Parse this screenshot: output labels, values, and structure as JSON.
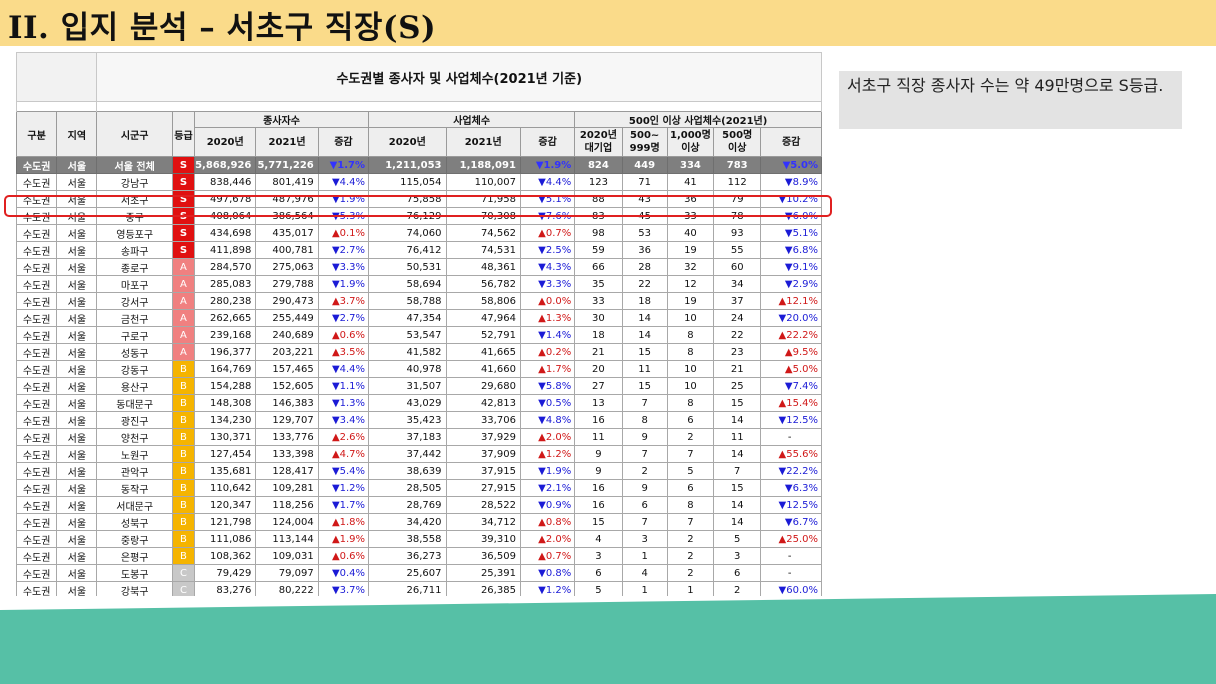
{
  "slide_title": "II. 입지 분석 – 서초구 직장(S)",
  "note": "서초구 직장 종사자 수는 약 49만명으로 S등급.",
  "table": {
    "caption": "수도권별 종사자 및 사업체수(2021년 기준)",
    "headers": {
      "gubun": "구분",
      "region": "지역",
      "district": "시군구",
      "grade": "등급",
      "workers": "종사자수",
      "businesses": "사업체수",
      "large": "500인 이상 사업체수(2021년)",
      "y2020": "2020년",
      "y2021": "2021년",
      "change": "증감",
      "large_corp": "2020년\n대기업",
      "b500_999": "500~\n999명",
      "b1000": "1,000명\n이상",
      "b500": "500명\n이상"
    },
    "rows": [
      {
        "g": "수도권",
        "r": "서울",
        "d": "서울 전체",
        "grade": "S",
        "w20": "5,868,926",
        "w21": "5,771,226",
        "wc": "▼1.7%",
        "wd": "down",
        "b20": "1,211,053",
        "b21": "1,188,091",
        "bc": "▼1.9%",
        "bd": "down",
        "lc": "824",
        "l1": "449",
        "l2": "334",
        "l3": "783",
        "lchg": "▼5.0%",
        "ld": "down"
      },
      {
        "g": "수도권",
        "r": "서울",
        "d": "강남구",
        "grade": "S",
        "w20": "838,446",
        "w21": "801,419",
        "wc": "▼4.4%",
        "wd": "down",
        "b20": "115,054",
        "b21": "110,007",
        "bc": "▼4.4%",
        "bd": "down",
        "lc": "123",
        "l1": "71",
        "l2": "41",
        "l3": "112",
        "lchg": "▼8.9%",
        "ld": "down"
      },
      {
        "g": "수도권",
        "r": "서울",
        "d": "서초구",
        "grade": "S",
        "w20": "497,678",
        "w21": "487,976",
        "wc": "▼1.9%",
        "wd": "down",
        "b20": "75,858",
        "b21": "71,958",
        "bc": "▼5.1%",
        "bd": "down",
        "lc": "88",
        "l1": "43",
        "l2": "36",
        "l3": "79",
        "lchg": "▼10.2%",
        "ld": "down"
      },
      {
        "g": "수도권",
        "r": "서울",
        "d": "중구",
        "grade": "S",
        "w20": "408,064",
        "w21": "386,564",
        "wc": "▼5.3%",
        "wd": "down",
        "b20": "76,129",
        "b21": "70,308",
        "bc": "▼7.6%",
        "bd": "down",
        "lc": "83",
        "l1": "45",
        "l2": "33",
        "l3": "78",
        "lchg": "▼6.0%",
        "ld": "down"
      },
      {
        "g": "수도권",
        "r": "서울",
        "d": "영등포구",
        "grade": "S",
        "w20": "434,698",
        "w21": "435,017",
        "wc": "▲0.1%",
        "wd": "up",
        "b20": "74,060",
        "b21": "74,562",
        "bc": "▲0.7%",
        "bd": "up",
        "lc": "98",
        "l1": "53",
        "l2": "40",
        "l3": "93",
        "lchg": "▼5.1%",
        "ld": "down"
      },
      {
        "g": "수도권",
        "r": "서울",
        "d": "송파구",
        "grade": "S",
        "w20": "411,898",
        "w21": "400,781",
        "wc": "▼2.7%",
        "wd": "down",
        "b20": "76,412",
        "b21": "74,531",
        "bc": "▼2.5%",
        "bd": "down",
        "lc": "59",
        "l1": "36",
        "l2": "19",
        "l3": "55",
        "lchg": "▼6.8%",
        "ld": "down"
      },
      {
        "g": "수도권",
        "r": "서울",
        "d": "종로구",
        "grade": "A",
        "w20": "284,570",
        "w21": "275,063",
        "wc": "▼3.3%",
        "wd": "down",
        "b20": "50,531",
        "b21": "48,361",
        "bc": "▼4.3%",
        "bd": "down",
        "lc": "66",
        "l1": "28",
        "l2": "32",
        "l3": "60",
        "lchg": "▼9.1%",
        "ld": "down"
      },
      {
        "g": "수도권",
        "r": "서울",
        "d": "마포구",
        "grade": "A",
        "w20": "285,083",
        "w21": "279,788",
        "wc": "▼1.9%",
        "wd": "down",
        "b20": "58,694",
        "b21": "56,782",
        "bc": "▼3.3%",
        "bd": "down",
        "lc": "35",
        "l1": "22",
        "l2": "12",
        "l3": "34",
        "lchg": "▼2.9%",
        "ld": "down"
      },
      {
        "g": "수도권",
        "r": "서울",
        "d": "강서구",
        "grade": "A",
        "w20": "280,238",
        "w21": "290,473",
        "wc": "▲3.7%",
        "wd": "up",
        "b20": "58,788",
        "b21": "58,806",
        "bc": "▲0.0%",
        "bd": "up",
        "lc": "33",
        "l1": "18",
        "l2": "19",
        "l3": "37",
        "lchg": "▲12.1%",
        "ld": "up"
      },
      {
        "g": "수도권",
        "r": "서울",
        "d": "금천구",
        "grade": "A",
        "w20": "262,665",
        "w21": "255,449",
        "wc": "▼2.7%",
        "wd": "down",
        "b20": "47,354",
        "b21": "47,964",
        "bc": "▲1.3%",
        "bd": "up",
        "lc": "30",
        "l1": "14",
        "l2": "10",
        "l3": "24",
        "lchg": "▼20.0%",
        "ld": "down"
      },
      {
        "g": "수도권",
        "r": "서울",
        "d": "구로구",
        "grade": "A",
        "w20": "239,168",
        "w21": "240,689",
        "wc": "▲0.6%",
        "wd": "up",
        "b20": "53,547",
        "b21": "52,791",
        "bc": "▼1.4%",
        "bd": "down",
        "lc": "18",
        "l1": "14",
        "l2": "8",
        "l3": "22",
        "lchg": "▲22.2%",
        "ld": "up"
      },
      {
        "g": "수도권",
        "r": "서울",
        "d": "성동구",
        "grade": "A",
        "w20": "196,377",
        "w21": "203,221",
        "wc": "▲3.5%",
        "wd": "up",
        "b20": "41,582",
        "b21": "41,665",
        "bc": "▲0.2%",
        "bd": "up",
        "lc": "21",
        "l1": "15",
        "l2": "8",
        "l3": "23",
        "lchg": "▲9.5%",
        "ld": "up"
      },
      {
        "g": "수도권",
        "r": "서울",
        "d": "강동구",
        "grade": "B",
        "w20": "164,769",
        "w21": "157,465",
        "wc": "▼4.4%",
        "wd": "down",
        "b20": "40,978",
        "b21": "41,660",
        "bc": "▲1.7%",
        "bd": "up",
        "lc": "20",
        "l1": "11",
        "l2": "10",
        "l3": "21",
        "lchg": "▲5.0%",
        "ld": "up"
      },
      {
        "g": "수도권",
        "r": "서울",
        "d": "용산구",
        "grade": "B",
        "w20": "154,288",
        "w21": "152,605",
        "wc": "▼1.1%",
        "wd": "down",
        "b20": "31,507",
        "b21": "29,680",
        "bc": "▼5.8%",
        "bd": "down",
        "lc": "27",
        "l1": "15",
        "l2": "10",
        "l3": "25",
        "lchg": "▼7.4%",
        "ld": "down"
      },
      {
        "g": "수도권",
        "r": "서울",
        "d": "동대문구",
        "grade": "B",
        "w20": "148,308",
        "w21": "146,383",
        "wc": "▼1.3%",
        "wd": "down",
        "b20": "43,029",
        "b21": "42,813",
        "bc": "▼0.5%",
        "bd": "down",
        "lc": "13",
        "l1": "7",
        "l2": "8",
        "l3": "15",
        "lchg": "▲15.4%",
        "ld": "up"
      },
      {
        "g": "수도권",
        "r": "서울",
        "d": "광진구",
        "grade": "B",
        "w20": "134,230",
        "w21": "129,707",
        "wc": "▼3.4%",
        "wd": "down",
        "b20": "35,423",
        "b21": "33,706",
        "bc": "▼4.8%",
        "bd": "down",
        "lc": "16",
        "l1": "8",
        "l2": "6",
        "l3": "14",
        "lchg": "▼12.5%",
        "ld": "down"
      },
      {
        "g": "수도권",
        "r": "서울",
        "d": "양천구",
        "grade": "B",
        "w20": "130,371",
        "w21": "133,776",
        "wc": "▲2.6%",
        "wd": "up",
        "b20": "37,183",
        "b21": "37,929",
        "bc": "▲2.0%",
        "bd": "up",
        "lc": "11",
        "l1": "9",
        "l2": "2",
        "l3": "11",
        "lchg": "-",
        "ld": "none"
      },
      {
        "g": "수도권",
        "r": "서울",
        "d": "노원구",
        "grade": "B",
        "w20": "127,454",
        "w21": "133,398",
        "wc": "▲4.7%",
        "wd": "up",
        "b20": "37,442",
        "b21": "37,909",
        "bc": "▲1.2%",
        "bd": "up",
        "lc": "9",
        "l1": "7",
        "l2": "7",
        "l3": "14",
        "lchg": "▲55.6%",
        "ld": "up"
      },
      {
        "g": "수도권",
        "r": "서울",
        "d": "관악구",
        "grade": "B",
        "w20": "135,681",
        "w21": "128,417",
        "wc": "▼5.4%",
        "wd": "down",
        "b20": "38,639",
        "b21": "37,915",
        "bc": "▼1.9%",
        "bd": "down",
        "lc": "9",
        "l1": "2",
        "l2": "5",
        "l3": "7",
        "lchg": "▼22.2%",
        "ld": "down"
      },
      {
        "g": "수도권",
        "r": "서울",
        "d": "동작구",
        "grade": "B",
        "w20": "110,642",
        "w21": "109,281",
        "wc": "▼1.2%",
        "wd": "down",
        "b20": "28,505",
        "b21": "27,915",
        "bc": "▼2.1%",
        "bd": "down",
        "lc": "16",
        "l1": "9",
        "l2": "6",
        "l3": "15",
        "lchg": "▼6.3%",
        "ld": "down"
      },
      {
        "g": "수도권",
        "r": "서울",
        "d": "서대문구",
        "grade": "B",
        "w20": "120,347",
        "w21": "118,256",
        "wc": "▼1.7%",
        "wd": "down",
        "b20": "28,769",
        "b21": "28,522",
        "bc": "▼0.9%",
        "bd": "down",
        "lc": "16",
        "l1": "6",
        "l2": "8",
        "l3": "14",
        "lchg": "▼12.5%",
        "ld": "down"
      },
      {
        "g": "수도권",
        "r": "서울",
        "d": "성북구",
        "grade": "B",
        "w20": "121,798",
        "w21": "124,004",
        "wc": "▲1.8%",
        "wd": "up",
        "b20": "34,420",
        "b21": "34,712",
        "bc": "▲0.8%",
        "bd": "up",
        "lc": "15",
        "l1": "7",
        "l2": "7",
        "l3": "14",
        "lchg": "▼6.7%",
        "ld": "down"
      },
      {
        "g": "수도권",
        "r": "서울",
        "d": "중랑구",
        "grade": "B",
        "w20": "111,086",
        "w21": "113,144",
        "wc": "▲1.9%",
        "wd": "up",
        "b20": "38,558",
        "b21": "39,310",
        "bc": "▲2.0%",
        "bd": "up",
        "lc": "4",
        "l1": "3",
        "l2": "2",
        "l3": "5",
        "lchg": "▲25.0%",
        "ld": "up"
      },
      {
        "g": "수도권",
        "r": "서울",
        "d": "은평구",
        "grade": "B",
        "w20": "108,362",
        "w21": "109,031",
        "wc": "▲0.6%",
        "wd": "up",
        "b20": "36,273",
        "b21": "36,509",
        "bc": "▲0.7%",
        "bd": "up",
        "lc": "3",
        "l1": "1",
        "l2": "2",
        "l3": "3",
        "lchg": "-",
        "ld": "none"
      },
      {
        "g": "수도권",
        "r": "서울",
        "d": "도봉구",
        "grade": "C",
        "w20": "79,429",
        "w21": "79,097",
        "wc": "▼0.4%",
        "wd": "down",
        "b20": "25,607",
        "b21": "25,391",
        "bc": "▼0.8%",
        "bd": "down",
        "lc": "6",
        "l1": "4",
        "l2": "2",
        "l3": "6",
        "lchg": "-",
        "ld": "none"
      },
      {
        "g": "수도권",
        "r": "서울",
        "d": "강북구",
        "grade": "C",
        "w20": "83,276",
        "w21": "80,222",
        "wc": "▼3.7%",
        "wd": "down",
        "b20": "26,711",
        "b21": "26,385",
        "bc": "▼1.2%",
        "bd": "down",
        "lc": "5",
        "l1": "1",
        "l2": "1",
        "l3": "2",
        "lchg": "▼60.0%",
        "ld": "down"
      }
    ]
  },
  "colors": {
    "title_bar": "#fadb8a",
    "footer_band": "#56c0a6",
    "grade_s": "#e01010",
    "grade_a": "#f08080",
    "grade_b": "#f5b400",
    "grade_c": "#c8c8c8",
    "decrease": "#1b1bd6",
    "increase": "#d01818",
    "highlight_box": "#e02020"
  }
}
